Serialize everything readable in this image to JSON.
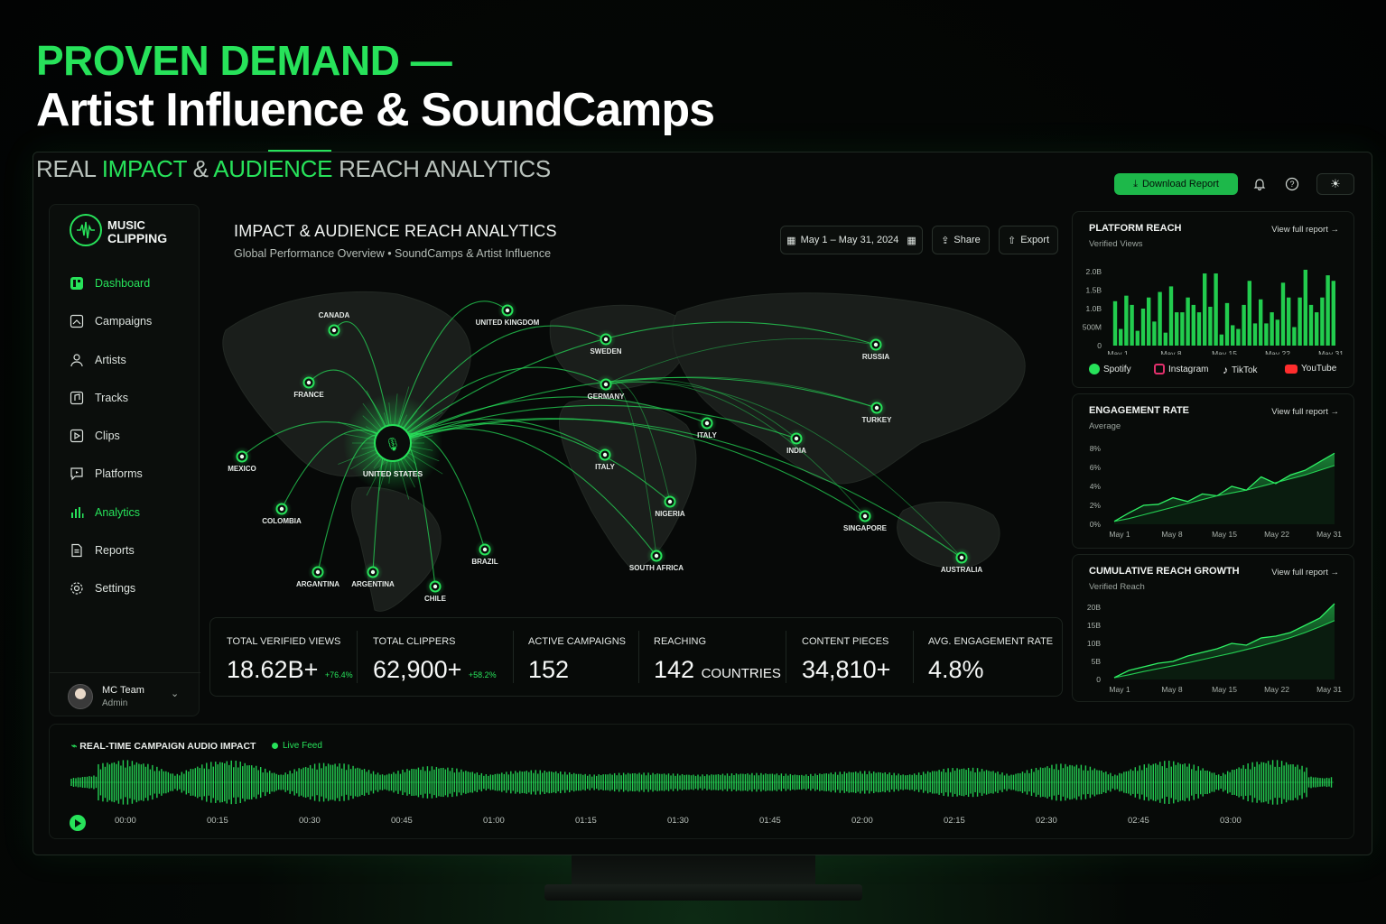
{
  "headline": {
    "line1": "PROVEN DEMAND —",
    "line2": "Artist Influence & SoundCamps"
  },
  "subhead": {
    "p1": "REAL ",
    "p2": "IMPACT",
    "p3": " & ",
    "p4": "AUDIENCE",
    "p5": " REACH ANALYTICS"
  },
  "topbar": {
    "download_label": "Download Report"
  },
  "brand": {
    "line1": "MUSIC",
    "line2": "CLIPPING"
  },
  "nav": [
    {
      "label": "Dashboard",
      "icon": "dashboard-icon"
    },
    {
      "label": "Campaigns",
      "icon": "campaigns-icon"
    },
    {
      "label": "Artists",
      "icon": "artists-icon"
    },
    {
      "label": "Tracks",
      "icon": "tracks-icon"
    },
    {
      "label": "Clips",
      "icon": "clips-icon"
    },
    {
      "label": "Platforms",
      "icon": "platforms-icon"
    },
    {
      "label": "Analytics",
      "icon": "analytics-icon"
    },
    {
      "label": "Reports",
      "icon": "reports-icon"
    },
    {
      "label": "Settings",
      "icon": "settings-icon"
    }
  ],
  "user": {
    "name": "MC Team",
    "role": "Admin"
  },
  "main": {
    "title": "IMPACT & AUDIENCE REACH ANALYTICS",
    "subtitle": "Global Performance Overview • SoundCamps & Artist Influence",
    "date_range": "May 1 – May 31, 2024",
    "share_label": "Share",
    "export_label": "Export"
  },
  "map": {
    "hub": "UNITED STATES",
    "locations": [
      {
        "label": "CANADA"
      },
      {
        "label": "UNITED KINGDOM"
      },
      {
        "label": "FRANCE"
      },
      {
        "label": "MEXICO"
      },
      {
        "label": "COLOMBIA"
      },
      {
        "label": "ARGENTINA"
      },
      {
        "label": "ARGANTINA"
      },
      {
        "label": "CHILE"
      },
      {
        "label": "BRAZIL"
      },
      {
        "label": "SWEDEN"
      },
      {
        "label": "GERMANY"
      },
      {
        "label": "ITALY"
      },
      {
        "label": "ITALY"
      },
      {
        "label": "NIGERIA"
      },
      {
        "label": "SOUTH AFRICA"
      },
      {
        "label": "RUSSIA"
      },
      {
        "label": "TURKEY"
      },
      {
        "label": "INDIA"
      },
      {
        "label": "SINGAPORE"
      },
      {
        "label": "AUSTRALIA"
      }
    ]
  },
  "stats": [
    {
      "label": "TOTAL VERIFIED VIEWS",
      "value": "18.62B+",
      "delta": "+76.4%"
    },
    {
      "label": "TOTAL CLIPPERS",
      "value": "62,900+",
      "delta": "+58.2%"
    },
    {
      "label": "ACTIVE CAMPAIGNS",
      "value": "152"
    },
    {
      "label": "REACHING",
      "value": "142",
      "unit": "COUNTRIES"
    },
    {
      "label": "CONTENT PIECES",
      "value": "34,810+"
    },
    {
      "label": "AVG. ENGAGEMENT RATE",
      "value": "4.8%"
    }
  ],
  "panels": {
    "platform_reach": {
      "title": "PLATFORM REACH",
      "subtitle": "Verified Views",
      "link": "View full report"
    },
    "engagement": {
      "title": "ENGAGEMENT RATE",
      "subtitle": "Average",
      "link": "View full report"
    },
    "cumulative": {
      "title": "CUMULATIVE REACH GROWTH",
      "subtitle": "Verified Reach",
      "link": "View full report"
    },
    "legend": [
      "Spotify",
      "Instagram",
      "TikTok",
      "YouTube"
    ]
  },
  "colors": {
    "accent": "#27e25a",
    "background": "#050806",
    "youtube": "#ff2d2d",
    "instagram": "#e1306c"
  },
  "chart_data": [
    {
      "type": "bar",
      "title": "PLATFORM REACH",
      "ylabel": "Verified Views",
      "yticks": [
        "0",
        "500M",
        "1.0B",
        "1.5B",
        "2.0B"
      ],
      "xticks": [
        "May 1",
        "May 8",
        "May 15",
        "May 22",
        "May 31"
      ],
      "ylim": [
        0,
        2000000000
      ],
      "values": [
        1200000000,
        450000000,
        1350000000,
        1100000000,
        400000000,
        1000000000,
        1300000000,
        650000000,
        1450000000,
        350000000,
        1600000000,
        900000000,
        900000000,
        1300000000,
        1100000000,
        900000000,
        1950000000,
        1050000000,
        1950000000,
        300000000,
        1150000000,
        550000000,
        450000000,
        1100000000,
        1750000000,
        600000000,
        1250000000,
        600000000,
        900000000,
        700000000,
        1700000000,
        1300000000,
        500000000,
        1300000000,
        2050000000,
        1100000000,
        900000000,
        1300000000,
        1900000000,
        1750000000
      ]
    },
    {
      "type": "area",
      "title": "ENGAGEMENT RATE",
      "ylabel": "Average",
      "yticks": [
        "0%",
        "2%",
        "4%",
        "6%",
        "8%"
      ],
      "xticks": [
        "May 1",
        "May 8",
        "May 15",
        "May 22",
        "May 31"
      ],
      "ylim": [
        0,
        8
      ],
      "x": [
        1,
        3,
        5,
        7,
        9,
        11,
        13,
        15,
        17,
        19,
        21,
        23,
        25,
        27,
        29,
        31
      ],
      "series": [
        {
          "values": [
            0.3,
            1.2,
            2.0,
            2.1,
            2.8,
            2.4,
            3.2,
            3.0,
            4.0,
            3.6,
            5.0,
            4.3,
            5.2,
            5.7,
            6.6,
            7.5
          ]
        },
        {
          "values": [
            0.3,
            0.6,
            1.0,
            1.4,
            1.8,
            2.2,
            2.6,
            3.0,
            3.3,
            3.6,
            4.0,
            4.4,
            4.8,
            5.2,
            5.7,
            6.2
          ]
        }
      ]
    },
    {
      "type": "area",
      "title": "CUMULATIVE REACH GROWTH",
      "ylabel": "Verified Reach",
      "yticks": [
        "0",
        "5B",
        "10B",
        "15B",
        "20B"
      ],
      "xticks": [
        "May 1",
        "May 8",
        "May 15",
        "May 22",
        "May 31"
      ],
      "ylim": [
        0,
        20
      ],
      "x": [
        1,
        3,
        5,
        7,
        9,
        11,
        13,
        15,
        17,
        19,
        21,
        23,
        25,
        27,
        29,
        31
      ],
      "series": [
        {
          "values": [
            0.5,
            2.5,
            3.5,
            4.5,
            5.0,
            6.5,
            7.5,
            8.5,
            10.0,
            9.5,
            11.5,
            12.0,
            13.0,
            15.0,
            17.0,
            21.0
          ]
        },
        {
          "values": [
            0.5,
            1.3,
            2.2,
            3.0,
            3.8,
            4.6,
            5.5,
            6.4,
            7.3,
            8.3,
            9.3,
            10.4,
            11.6,
            13.0,
            14.6,
            16.3
          ]
        }
      ]
    },
    {
      "type": "bar",
      "title": "REAL-TIME CAMPAIGN AUDIO IMPACT",
      "xticks": [
        "00:00",
        "00:15",
        "00:30",
        "00:45",
        "01:00",
        "01:15",
        "01:30",
        "01:45",
        "02:00",
        "02:15",
        "02:30",
        "02:45",
        "03:00"
      ]
    }
  ]
}
